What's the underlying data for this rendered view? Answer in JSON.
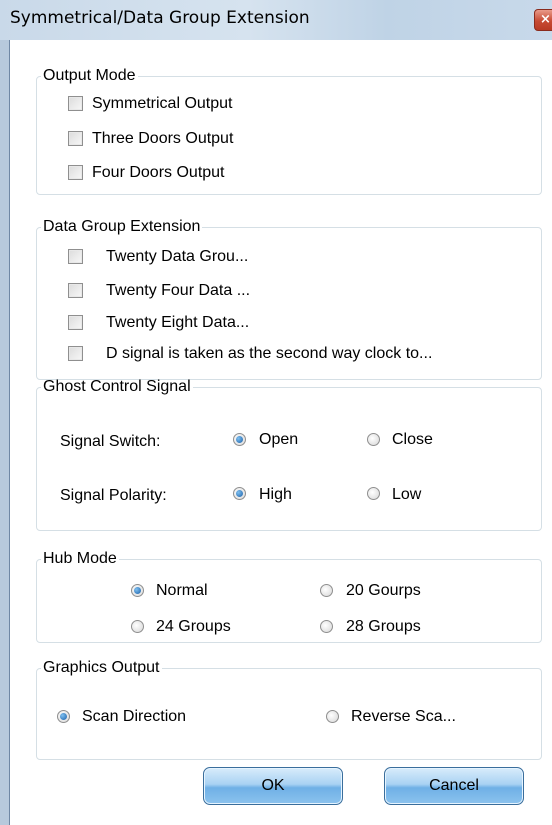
{
  "window": {
    "title": "Symmetrical/Data Group Extension"
  },
  "output_mode": {
    "legend": "Output Mode",
    "items": [
      {
        "label": "Symmetrical Output",
        "checked": false
      },
      {
        "label": "Three Doors Output",
        "checked": false
      },
      {
        "label": "Four Doors Output",
        "checked": false
      }
    ]
  },
  "data_group_extension": {
    "legend": "Data Group Extension",
    "items": [
      {
        "label": "Twenty Data Grou...",
        "checked": false
      },
      {
        "label": "Twenty Four Data ...",
        "checked": false
      },
      {
        "label": "Twenty Eight Data...",
        "checked": false
      },
      {
        "label": "D signal is taken as the second way clock to...",
        "checked": false
      }
    ]
  },
  "ghost_control_signal": {
    "legend": "Ghost Control Signal",
    "signal_switch": {
      "label": "Signal Switch:",
      "open": "Open",
      "close": "Close",
      "selected": "Open"
    },
    "signal_polarity": {
      "label": "Signal Polarity:",
      "high": "High",
      "low": "Low",
      "selected": "High"
    }
  },
  "hub_mode": {
    "legend": "Hub Mode",
    "options": [
      "Normal",
      "20 Gourps",
      "24 Groups",
      "28 Groups"
    ],
    "selected": "Normal"
  },
  "graphics_output": {
    "legend": "Graphics Output",
    "options": [
      "Scan Direction",
      "Reverse Sca..."
    ],
    "selected": "Scan Direction"
  },
  "buttons": {
    "ok": "OK",
    "cancel": "Cancel"
  }
}
